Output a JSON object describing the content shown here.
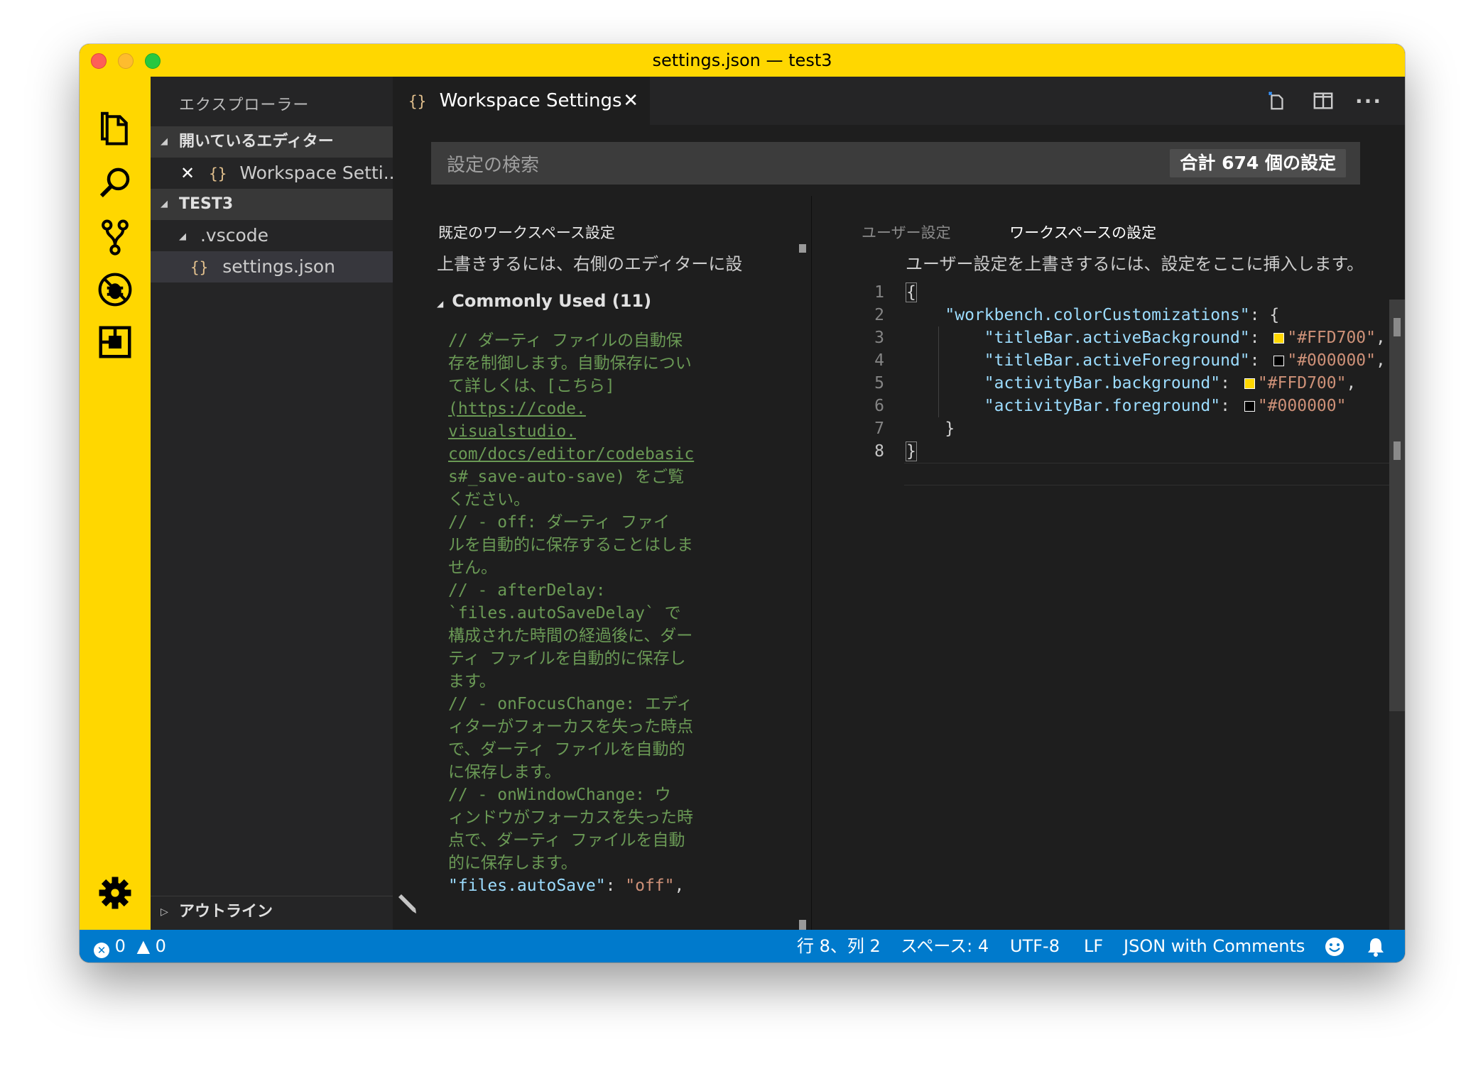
{
  "window": {
    "title": "settings.json — test3"
  },
  "colors": {
    "accent": "#FFD700",
    "status_bar": "#007acc",
    "editor_bg": "#1e1e1e"
  },
  "activity_bar": {
    "icons": [
      "explorer-icon",
      "search-icon",
      "source-control-icon",
      "debug-icon",
      "extensions-icon",
      "gear-icon"
    ]
  },
  "sidebar": {
    "title": "エクスプローラー",
    "open_editors_label": "開いているエディター",
    "open_editor_item": "Workspace Setti...",
    "workspace_label": "TEST3",
    "folder_label": ".vscode",
    "file_label": "settings.json",
    "outline_label": "アウトライン"
  },
  "tab": {
    "label": "Workspace Settings",
    "icon": "{}"
  },
  "search": {
    "placeholder": "設定の検索",
    "count_label": "合計 674 個の設定"
  },
  "left_pane": {
    "header": "既定のワークスペース設定",
    "description": "上書きするには、右側のエディターに設",
    "group_label": "Commonly Used (11)",
    "comment_lines": [
      "// ダーティ ファイルの自動保",
      "存を制御します。自動保存につい",
      "て詳しくは、[こちら]",
      "(https://code.",
      "visualstudio.",
      "com/docs/editor/codebasic",
      "s#_save-auto-save) をご覧",
      "ください。",
      "//  - off: ダーティ ファイ",
      "ルを自動的に保存することはしま",
      "せん。",
      "//  - afterDelay:",
      "`files.autoSaveDelay` で",
      "構成された時間の経過後に、ダー",
      "ティ ファイルを自動的に保存し",
      "ます。",
      "//  - onFocusChange: エディ",
      "ィターがフォーカスを失った時点",
      "で、ダーティ ファイルを自動的",
      "に保存します。",
      "//  - onWindowChange: ウ",
      "ィンドウがフォーカスを失った時",
      "点で、ダーティ ファイルを自動",
      "的に保存します。"
    ],
    "setting_key": "\"files.autoSave\"",
    "setting_value": "\"off\""
  },
  "right_pane": {
    "tab_user": "ユーザー設定",
    "tab_workspace": "ワークスペースの設定",
    "description": "ユーザー設定を上書きするには、設定をここに挿入します。",
    "line_numbers": [
      "1",
      "2",
      "3",
      "4",
      "5",
      "6",
      "7",
      "8"
    ],
    "root_key": "\"workbench.colorCustomizations\"",
    "entries": [
      {
        "key": "\"titleBar.activeBackground\"",
        "value": "\"#FFD700\"",
        "swatch": "#FFD700"
      },
      {
        "key": "\"titleBar.activeForeground\"",
        "value": "\"#000000\"",
        "swatch": "#000000"
      },
      {
        "key": "\"activityBar.background\"",
        "value": "\"#FFD700\"",
        "swatch": "#FFD700"
      },
      {
        "key": "\"activityBar.foreground\"",
        "value": "\"#000000\"",
        "swatch": "#000000"
      }
    ]
  },
  "status_bar": {
    "errors": "0",
    "warnings": "0",
    "position": "行 8、列 2",
    "indent": "スペース: 4",
    "encoding": "UTF-8",
    "eol": "LF",
    "language": "JSON with Comments"
  }
}
